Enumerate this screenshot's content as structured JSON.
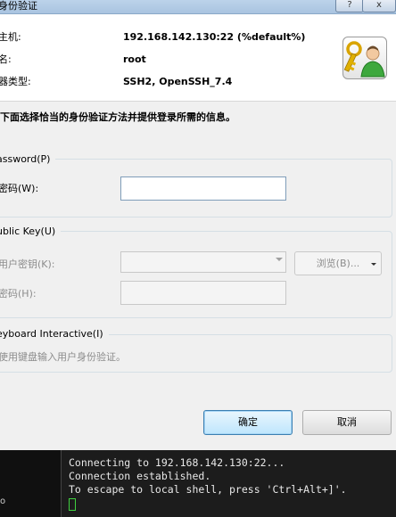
{
  "window": {
    "title": "身份验证",
    "help_button": "?",
    "close_button": "x"
  },
  "info": {
    "host_label": "主机:",
    "host_value": "192.168.142.130:22 (%default%)",
    "name_label": "名:",
    "name_value": "root",
    "server_type_label": "器类型:",
    "server_type_value": "SSH2, OpenSSH_7.4",
    "icon": "key-user-icon"
  },
  "instruction": "下面选择恰当的身份验证方法并提供登录所需的信息。",
  "password_group": {
    "title": "assword(P)",
    "field_label": "密码(W):",
    "field_value": ""
  },
  "pubkey_group": {
    "title": "ublic Key(U)",
    "user_key_label": "用户密钥(K):",
    "user_key_value": "",
    "browse_button": "浏览(B)...",
    "passphrase_label": "密码(H):",
    "passphrase_value": ""
  },
  "keyboard_group": {
    "title": "eyboard Interactive(I)",
    "description": "使用键盘输入用户身份验证。"
  },
  "buttons": {
    "ok": "确定",
    "cancel": "取消"
  },
  "terminal": {
    "side_text": "o",
    "lines": [
      "Connecting to 192.168.142.130:22...",
      "Connection established.",
      "To escape to local shell, press 'Ctrl+Alt+]'."
    ]
  },
  "colors": {
    "dialog_bg": "#f0f0f0",
    "terminal_bg": "#1c1c1c",
    "cursor": "#3fd03f",
    "default_button": "#bee6fd"
  }
}
